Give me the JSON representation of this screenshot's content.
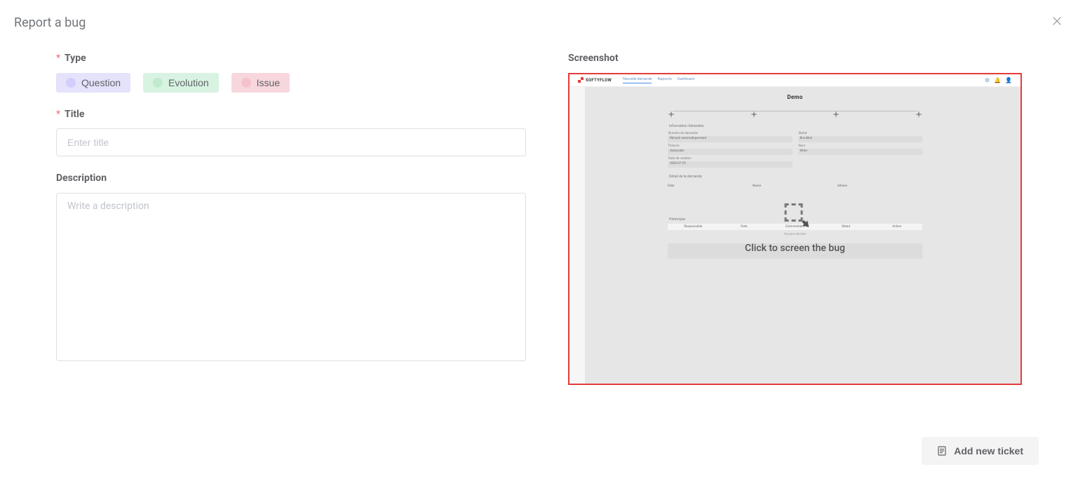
{
  "dialog": {
    "title": "Report a bug"
  },
  "form": {
    "type_label": "Type",
    "type_options": {
      "question": "Question",
      "evolution": "Evolution",
      "issue": "Issue"
    },
    "title_label": "Title",
    "title_placeholder": "Enter title",
    "description_label": "Description",
    "description_placeholder": "Write a description"
  },
  "screenshot": {
    "label": "Screenshot",
    "overlay_text": "Click to screen the bug",
    "preview": {
      "brand": "SOFTYFLOW",
      "tabs": [
        "Nouvelle demande",
        "Rapports",
        "Dashboard"
      ],
      "page_title": "Demo",
      "section_info": "Information Génerales",
      "fields": {
        "numero_label": "Numéro de demande",
        "numero_value": "Rémplir automatiquement",
        "statut_label": "Statut",
        "statut_value": "Brouillon",
        "prenom_label": "Prénom",
        "prenom_value": "Automatic",
        "nom_label": "Nom",
        "nom_value": "Write",
        "date_label": "Date de création",
        "date_value": "2022-07-25"
      },
      "section_detail": "Détail de la demande",
      "detail_cols": [
        "Date",
        "Name",
        "Adress"
      ],
      "section_hist": "Historique",
      "hist_cols": [
        "Responsable",
        "Date",
        "Commentaire",
        "Statut",
        "Action"
      ],
      "hist_empty": "Aucune donnée"
    }
  },
  "footer": {
    "add_button": "Add new ticket"
  }
}
